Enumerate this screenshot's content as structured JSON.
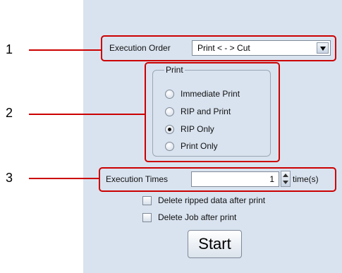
{
  "callouts": [
    "1",
    "2",
    "3"
  ],
  "execution_order": {
    "label": "Execution Order",
    "selected": "Print < - > Cut"
  },
  "print_group": {
    "legend": "Print",
    "options": [
      {
        "label": "Immediate Print",
        "checked": false
      },
      {
        "label": "RIP and Print",
        "checked": false
      },
      {
        "label": "RIP Only",
        "checked": true
      },
      {
        "label": "Print Only",
        "checked": false
      }
    ]
  },
  "execution_times": {
    "label": "Execution Times",
    "value": "1",
    "unit": "time(s)"
  },
  "checkboxes": [
    {
      "label": "Delete ripped data after print",
      "checked": false
    },
    {
      "label": "Delete Job after print",
      "checked": false
    }
  ],
  "start_button": "Start",
  "colors": {
    "panel": "#d9e3ef",
    "highlight": "#cc0000"
  }
}
